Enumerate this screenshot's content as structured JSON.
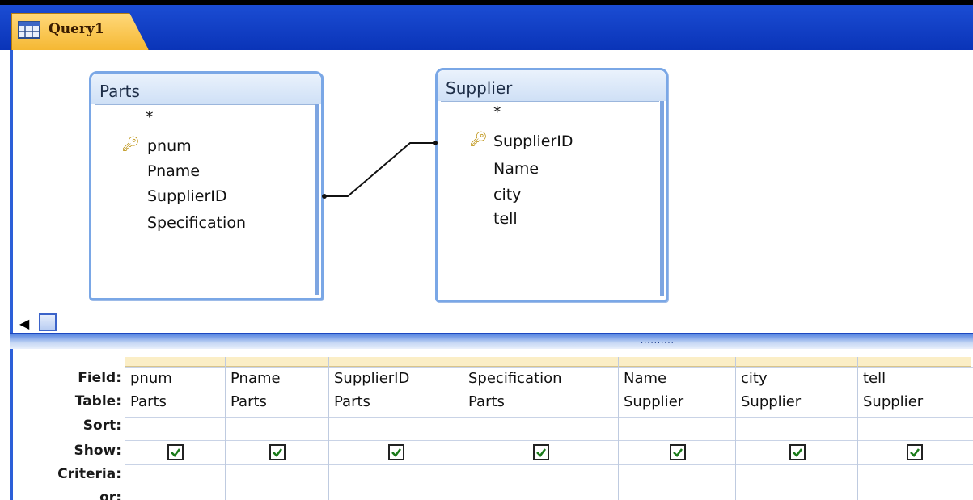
{
  "tab": {
    "title": "Query1"
  },
  "tables": [
    {
      "name": "Parts",
      "fields": [
        "*",
        "pnum",
        "Pname",
        "SupplierID",
        "Specification"
      ],
      "key_field": "pnum"
    },
    {
      "name": "Supplier",
      "fields": [
        "*",
        "SupplierID",
        "Name",
        "city",
        "tell"
      ],
      "key_field": "SupplierID"
    }
  ],
  "grid": {
    "row_labels": [
      "Field:",
      "Table:",
      "Sort:",
      "Show:",
      "Criteria:",
      "or:"
    ],
    "columns": [
      {
        "field": "pnum",
        "table": "Parts",
        "show": true
      },
      {
        "field": "Pname",
        "table": "Parts",
        "show": true
      },
      {
        "field": "SupplierID",
        "table": "Parts",
        "show": true
      },
      {
        "field": "Specification",
        "table": "Parts",
        "show": true
      },
      {
        "field": "Name",
        "table": "Supplier",
        "show": true
      },
      {
        "field": "city",
        "table": "Supplier",
        "show": true
      },
      {
        "field": "tell",
        "table": "Supplier",
        "show": true
      }
    ]
  },
  "splitter_grip": "..........",
  "icons": {
    "key": "key-icon",
    "query": "query-icon",
    "scroll_left": "arrow-left-icon",
    "checkbox": "checkbox-checked-icon"
  },
  "colors": {
    "title_bar": "#0a34b8",
    "tab": "#f5b833",
    "table_border": "#7aa7e6",
    "grid_header": "#fbeec6"
  }
}
